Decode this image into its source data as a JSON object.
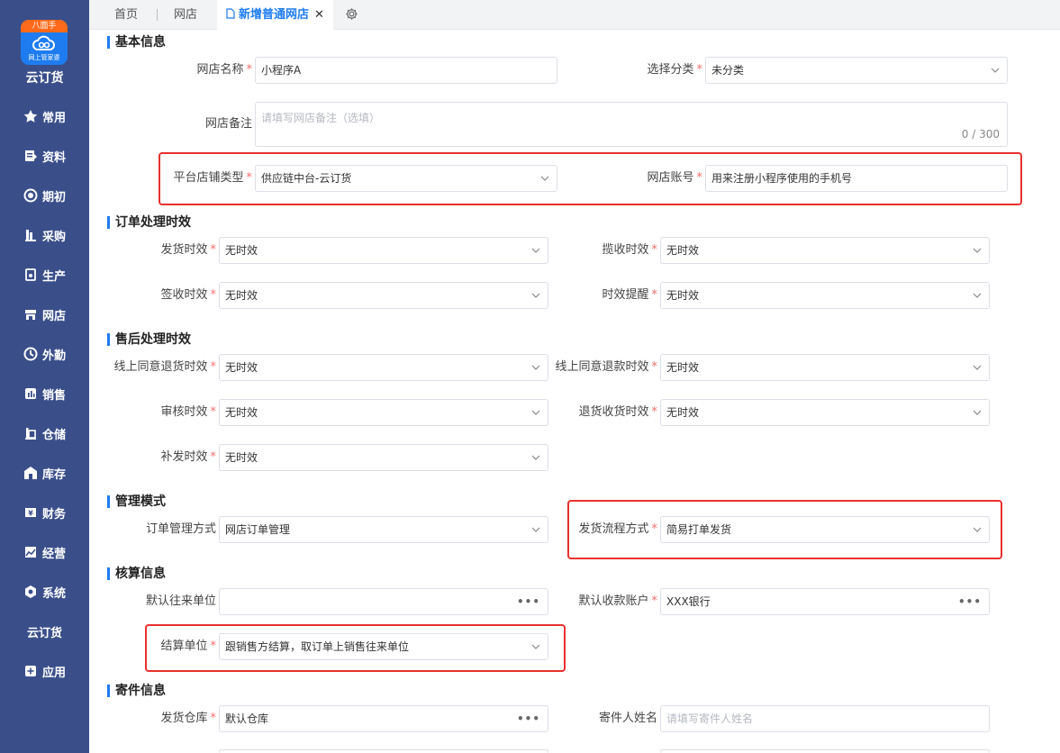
{
  "sidebar": {
    "logo_top": "八面手",
    "logo_sub": "网上管家婆",
    "brand": "云订货",
    "items": [
      {
        "label": "常用",
        "icon": "star-icon"
      },
      {
        "label": "资料",
        "icon": "document-icon"
      },
      {
        "label": "期初",
        "icon": "target-icon"
      },
      {
        "label": "采购",
        "icon": "purchase-icon"
      },
      {
        "label": "生产",
        "icon": "production-icon"
      },
      {
        "label": "网店",
        "icon": "shop-icon"
      },
      {
        "label": "外勤",
        "icon": "field-icon"
      },
      {
        "label": "销售",
        "icon": "sales-icon"
      },
      {
        "label": "仓储",
        "icon": "warehouse-icon"
      },
      {
        "label": "库存",
        "icon": "inventory-icon"
      },
      {
        "label": "财务",
        "icon": "finance-icon"
      },
      {
        "label": "经营",
        "icon": "business-icon"
      },
      {
        "label": "系统",
        "icon": "system-icon"
      },
      {
        "label": "云订货",
        "icon": ""
      },
      {
        "label": "应用",
        "icon": "apps-icon"
      }
    ]
  },
  "tabs": {
    "home": "首页",
    "shop": "网店",
    "active": "新增普通网店",
    "close": "✕"
  },
  "basic": {
    "title": "基本信息",
    "shop_name_label": "网店名称",
    "shop_name_value": "小程序A",
    "category_label": "选择分类",
    "category_value": "未分类",
    "remark_label": "网店备注",
    "remark_placeholder": "请填写网店备注（选填）",
    "remark_counter": "0 / 300",
    "platform_type_label": "平台店铺类型",
    "platform_type_value": "供应链中台-云订货",
    "account_label": "网店账号",
    "account_value": "用来注册小程序使用的手机号"
  },
  "order_timing": {
    "title": "订单处理时效",
    "ship_label": "发货时效",
    "ship_value": "无时效",
    "pickup_label": "揽收时效",
    "pickup_value": "无时效",
    "sign_label": "签收时效",
    "sign_value": "无时效",
    "remind_label": "时效提醒",
    "remind_value": "无时效"
  },
  "aftersale_timing": {
    "title": "售后处理时效",
    "return_goods_label": "线上同意退货时效",
    "return_goods_value": "无时效",
    "refund_label": "线上同意退款时效",
    "refund_value": "无时效",
    "audit_label": "审核时效",
    "audit_value": "无时效",
    "receive_label": "退货收货时效",
    "receive_value": "无时效",
    "resend_label": "补发时效",
    "resend_value": "无时效"
  },
  "management": {
    "title": "管理模式",
    "order_mode_label": "订单管理方式",
    "order_mode_value": "网店订单管理",
    "ship_flow_label": "发货流程方式",
    "ship_flow_value": "简易打单发货"
  },
  "accounting": {
    "title": "核算信息",
    "default_partner_label": "默认往来单位",
    "default_partner_value": "",
    "default_account_label": "默认收款账户",
    "default_account_value": "XXX银行",
    "settle_label": "结算单位",
    "settle_value": "跟销售方结算，取订单上销售往来单位",
    "dots": "•••"
  },
  "shipping": {
    "title": "寄件信息",
    "warehouse_label": "发货仓库",
    "warehouse_value": "默认仓库",
    "sender_label": "寄件人姓名",
    "sender_placeholder": "请填写寄件人姓名"
  },
  "colors": {
    "sidebar": "#3a4f8a",
    "accent": "#1e7cf0",
    "highlight": "#e8312f",
    "required": "#f56c6c"
  }
}
